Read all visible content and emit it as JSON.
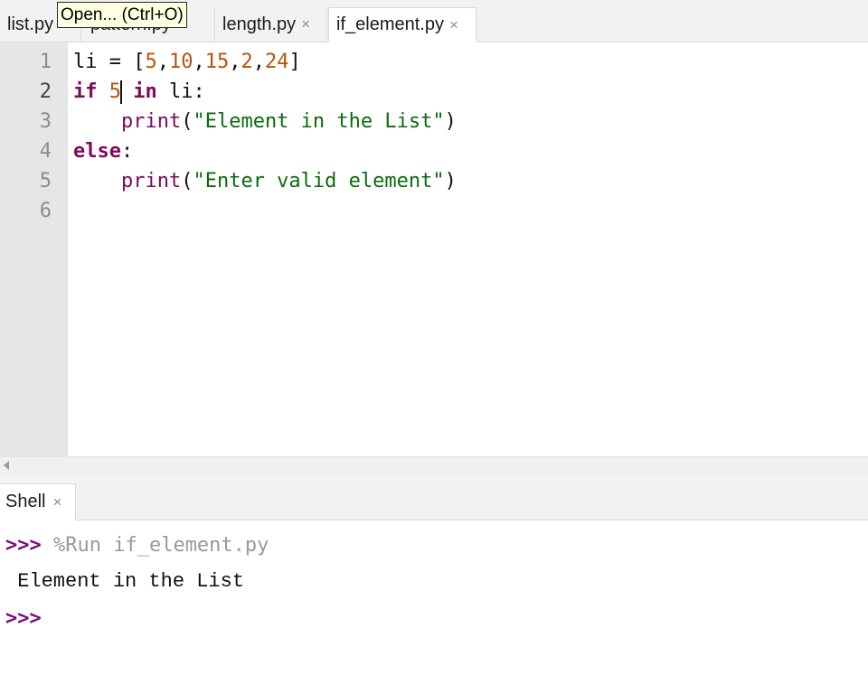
{
  "editor_tabs": [
    {
      "label": "list.py",
      "close": "×"
    },
    {
      "label": "pattern.py",
      "close": "×"
    },
    {
      "label": "length.py",
      "close": "×"
    },
    {
      "label": "if_element.py",
      "close": "×",
      "active": true
    }
  ],
  "tooltip": "Open... (Ctrl+O)",
  "line_numbers": [
    "1",
    "2",
    "3",
    "4",
    "5",
    "6"
  ],
  "code": {
    "line1": {
      "var": "li",
      "op": " = ",
      "open": "[",
      "n1": "5",
      "c1": ",",
      "n2": "10",
      "c2": ",",
      "n3": "15",
      "c3": ",",
      "n4": "2",
      "c4": ",",
      "n5": "24",
      "close": "]"
    },
    "line2": {
      "kw_if": "if",
      "sp1": " ",
      "num": "5",
      "sp2": " ",
      "kw_in": "in",
      "rest": " li:"
    },
    "line3": {
      "indent": "    ",
      "fn": "print",
      "open": "(",
      "str": "\"Element in the List\"",
      "close": ")"
    },
    "line4": {
      "kw_else": "else",
      "colon": ":"
    },
    "line5": {
      "indent": "    ",
      "fn": "print",
      "open": "(",
      "str": "\"Enter valid element\"",
      "close": ")"
    }
  },
  "shell_tab": {
    "label": "Shell",
    "close": "×"
  },
  "shell": {
    "prompt": ">>>",
    "command": " %Run if_element.py",
    "output": " Element in the List"
  },
  "colors": {
    "keyword": "#7a0b5d",
    "number": "#b5540a",
    "string": "#0b6b0b",
    "prompt": "#7a0b7a",
    "gutter": "#e6e6e6",
    "tooltip_bg": "#ffffe1"
  }
}
